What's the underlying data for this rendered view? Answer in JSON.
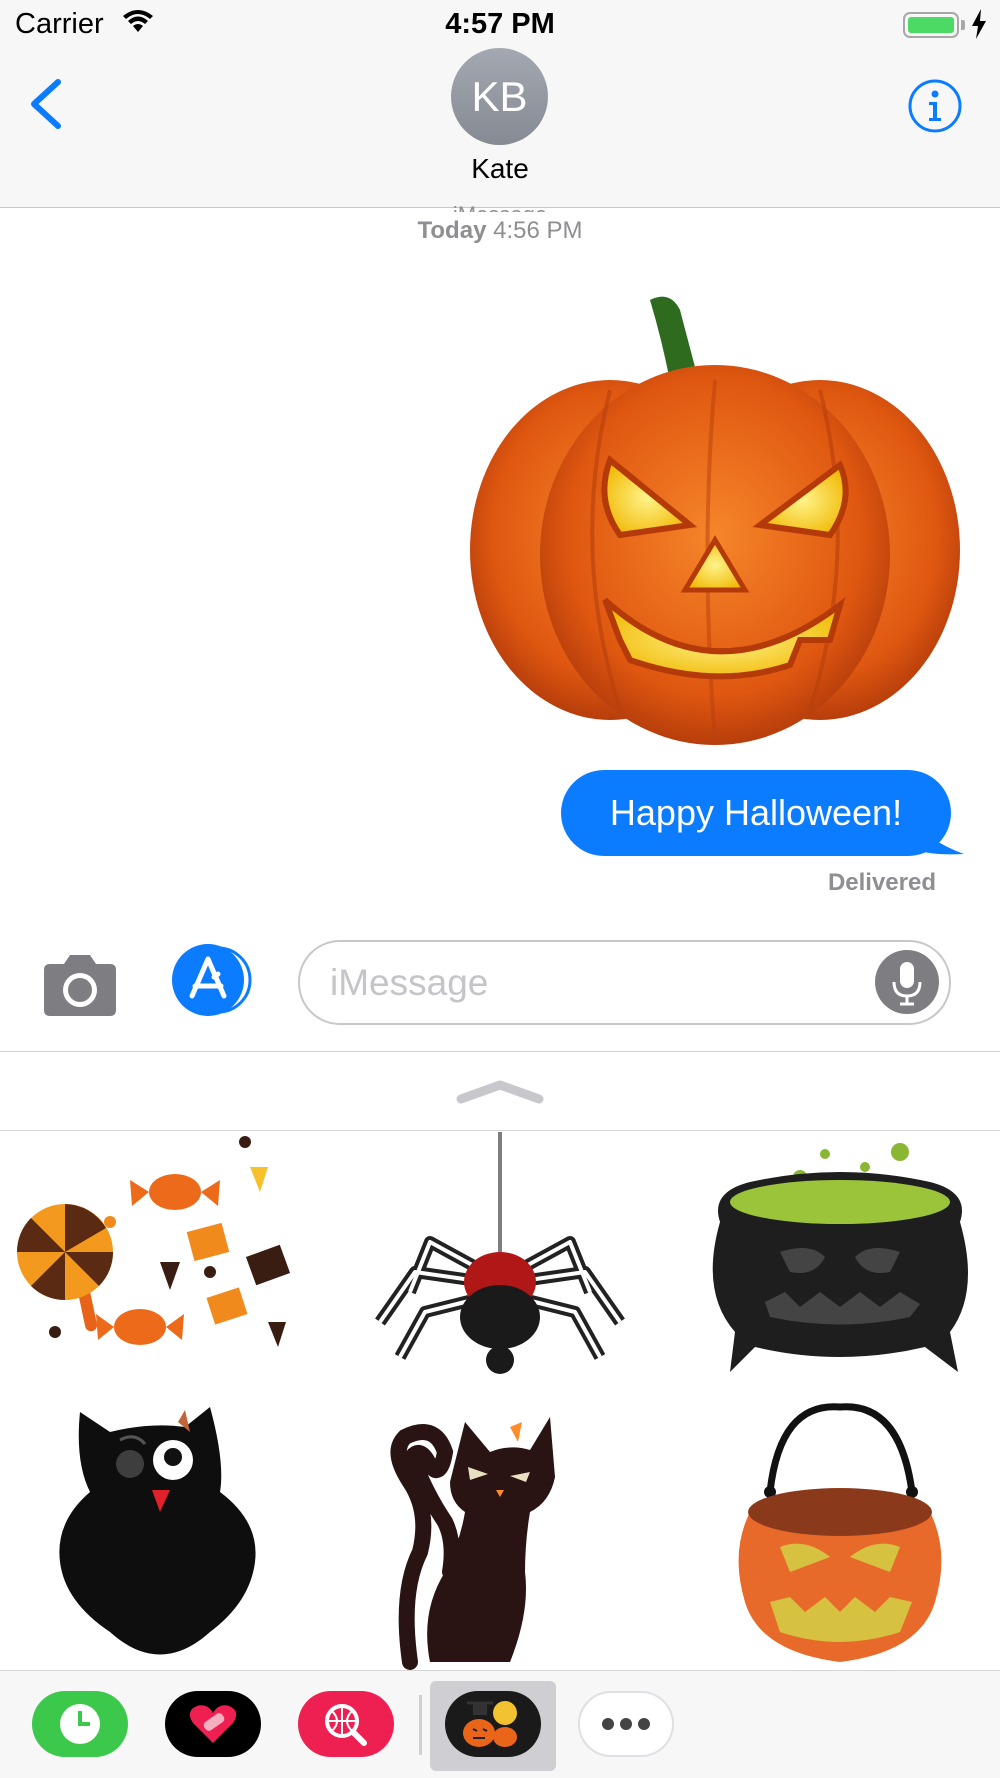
{
  "status_bar": {
    "carrier": "Carrier",
    "time": "4:57 PM",
    "battery_color": "#4cd964"
  },
  "header": {
    "contact_initials": "KB",
    "contact_name": "Kate",
    "back_icon": "chevron-left-icon",
    "info_icon": "info-icon",
    "accent_color": "#0b7cff"
  },
  "conversation": {
    "service_label": "iMessage",
    "timestamp_day": "Today",
    "timestamp_time": "4:56 PM",
    "sticker": "jack-o-lantern-sticker",
    "messages": [
      {
        "direction": "outgoing",
        "text": "Happy Halloween!"
      }
    ],
    "delivery_status": "Delivered",
    "bubble_color": "#0b7cff"
  },
  "input_bar": {
    "placeholder": "iMessage",
    "value": ""
  },
  "sticker_drawer": {
    "stickers": [
      "candy-sticker",
      "spider-sticker",
      "cauldron-sticker",
      "owl-sticker",
      "black-cat-sticker",
      "pumpkin-basket-sticker"
    ]
  },
  "app_tray": {
    "apps": [
      {
        "name": "clock-app-icon",
        "color": "#3cc84a"
      },
      {
        "name": "heart-bandage-app-icon",
        "color": "#000000"
      },
      {
        "name": "web-search-app-icon",
        "color": "#ee2052"
      },
      {
        "name": "halloween-stickers-app-icon",
        "selected": true
      },
      {
        "name": "more-apps-icon"
      }
    ]
  }
}
